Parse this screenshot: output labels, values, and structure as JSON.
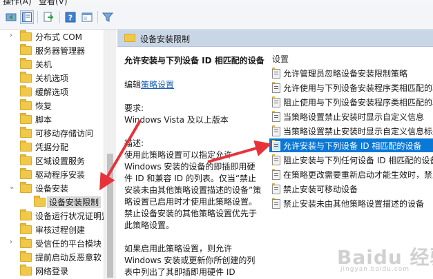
{
  "menubar": {
    "items": [
      "操作(A)",
      "查看(V)"
    ]
  },
  "tree": {
    "items": [
      {
        "label": "分布式 COM",
        "arrow": "›",
        "indent": 0
      },
      {
        "label": "服务器管理器",
        "arrow": "",
        "indent": 0
      },
      {
        "label": "关机",
        "arrow": "",
        "indent": 0
      },
      {
        "label": "关机选项",
        "arrow": "",
        "indent": 0
      },
      {
        "label": "缓解选项",
        "arrow": "",
        "indent": 0
      },
      {
        "label": "恢复",
        "arrow": "",
        "indent": 0
      },
      {
        "label": "脚本",
        "arrow": "",
        "indent": 0
      },
      {
        "label": "可移动存储访问",
        "arrow": "",
        "indent": 0
      },
      {
        "label": "凭据分配",
        "arrow": "",
        "indent": 0
      },
      {
        "label": "区域设置服务",
        "arrow": "",
        "indent": 0
      },
      {
        "label": "驱动程序安装",
        "arrow": "",
        "indent": 0
      },
      {
        "label": "设备安装",
        "arrow": "⌄",
        "indent": 0
      },
      {
        "label": "设备安装限制",
        "arrow": "",
        "indent": 1
      },
      {
        "label": "设备运行状况证明监",
        "arrow": "",
        "indent": 0
      },
      {
        "label": "审核过程创建",
        "arrow": "",
        "indent": 0
      },
      {
        "label": "受信任的平台模块",
        "arrow": "›",
        "indent": 0
      },
      {
        "label": "提前启动反恶意软",
        "arrow": "",
        "indent": 0
      },
      {
        "label": "网络登录",
        "arrow": "",
        "indent": 0
      }
    ]
  },
  "right_header": {
    "title": "设备安装限制"
  },
  "description": {
    "heading": "允许安装与下列设备 ID 相匹配的设备",
    "edit_prefix": "编辑",
    "edit_link": "策略设置",
    "requirements_label": "要求:",
    "requirements_value": "Windows Vista 及以上版本",
    "desc_label": "描述:",
    "desc_text": "使用此策略设置可以指定允许 Windows 安装的设备的即插即用硬件 ID 和兼容 ID 的列表。仅当“禁止安装未由其他策略设置描述的设备”策略设置已启用时才使用此策略设置。禁止设备安装的其他策略设置优先于此策略设置。",
    "desc_text2": "如果启用此策略设置，则允许 Windows 安装或更新你所创建的列表中列出了其即插即用硬件 ID"
  },
  "settings": {
    "column_header": "设置",
    "items": [
      "允许管理员忽略设备安装限制策略",
      "允许使用与下列设备安装程序类相匹配的驱动程序安装设备",
      "阻止使用与下列设备安装程序类相匹配的驱动程序安装设备",
      "当策略设置禁止安装时显示自定义信息",
      "当策略设置禁止安装时显示自定义信息标题",
      "允许安装与下列设备 ID 相匹配的设备",
      "阻止安装与下列任何设备 ID 相匹配的设备",
      "在策略更改需要重新启动才能生效时，禁止",
      "禁止安装可移动设备",
      "禁止安装未由其他策略设置描述的设备"
    ],
    "selected_index": 5
  },
  "watermark": {
    "text": "Baidu 经验",
    "sub": "jingyan.baidu.com"
  },
  "colors": {
    "accent": "#0a78d7",
    "annotation_arrow": "#e8323a",
    "header_bg": "#c9d6e6"
  }
}
